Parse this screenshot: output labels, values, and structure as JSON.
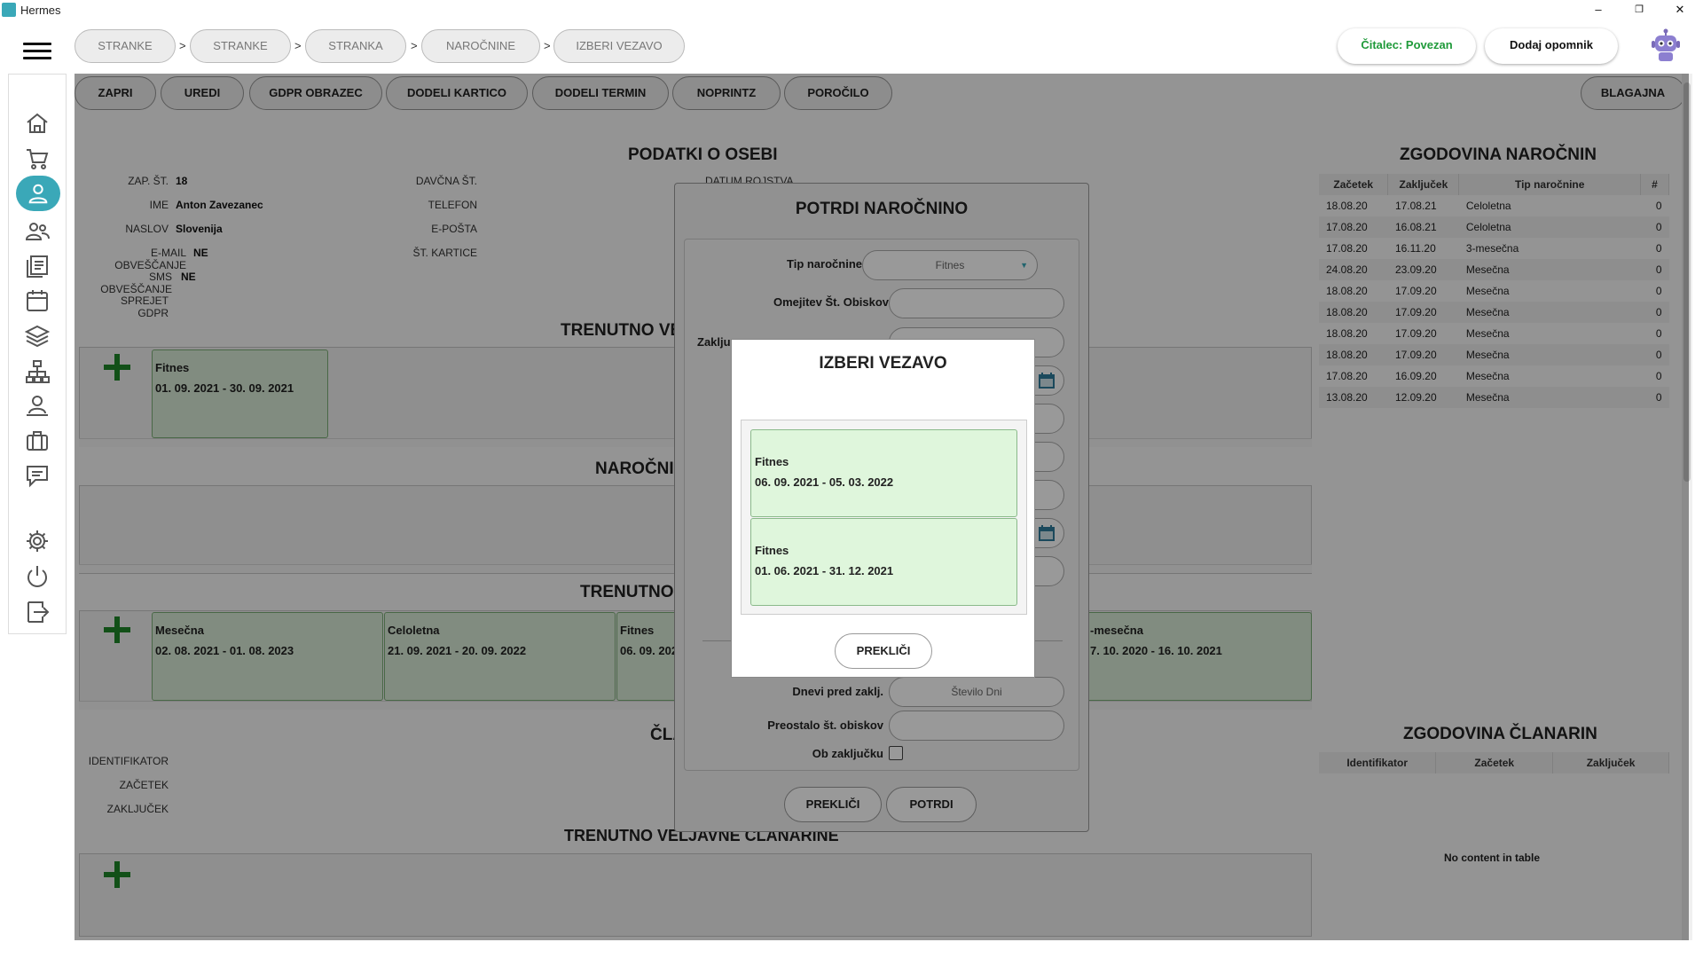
{
  "window": {
    "title": "Hermes",
    "minimize": "–",
    "restore": "❐",
    "close": "✕"
  },
  "breadcrumb": [
    {
      "label": "STRANKE"
    },
    {
      "label": "STRANKE"
    },
    {
      "label": "STRANKA"
    },
    {
      "label": "NAROČNINE"
    },
    {
      "label": "IZBERI VEZAVO"
    }
  ],
  "breadcrumb_sep": ">",
  "header": {
    "reader_status": "Čitalec: Povezan",
    "add_reminder": "Dodaj opomnik",
    "reader_color": "#1f9a3a"
  },
  "sidebar": {
    "icons": [
      "home-icon",
      "cart-icon",
      "person-icon",
      "people-icon",
      "documents-icon",
      "calendar-icon",
      "layers-icon",
      "network-icon",
      "user-desk-icon",
      "briefcase-icon",
      "chat-icon",
      "gear-icon",
      "power-icon",
      "logout-icon"
    ]
  },
  "toolbar": {
    "buttons": [
      "ZAPRI",
      "UREDI",
      "GDPR OBRAZEC",
      "DODELI KARTICO",
      "DODELI TERMIN",
      "NOPRINTZ",
      "POROČILO"
    ],
    "cashier": "BLAGAJNA"
  },
  "person": {
    "title": "PODATKI O OSEBI",
    "zap_label": "ZAP. ŠT.",
    "zap_value": "18",
    "ime_label": "IME",
    "ime_value": "Anton Zavezanec",
    "naslov_label": "NASLOV",
    "naslov_value": "Slovenija",
    "email_label": "E-MAIL OBVEŠČANJE",
    "email_value": "NE",
    "sms_label": "SMS OBVEŠČANJE",
    "sms_value": "NE",
    "gdpr_label": "SPREJET GDPR",
    "davcna_label": "DAVČNA ŠT.",
    "telefon_label": "TELEFON",
    "eposta_label": "E-POŠTA",
    "kartica_label": "ŠT. KARTICE",
    "datum_label": "DATUM ROJSTVA"
  },
  "current_valid": {
    "title": "TRENUTNO VE",
    "card_name": "Fitnes",
    "card_range": "01. 09. 2021 - 30. 09. 2021"
  },
  "subscriptions": {
    "title": "NAROČNI"
  },
  "current_block": {
    "title": "TRENUTNO V",
    "cards": [
      {
        "name": "Mesečna",
        "range": "02. 08. 2021 - 01. 08. 2023"
      },
      {
        "name": "Celoletna",
        "range": "21. 09. 2021 - 20. 09. 2022"
      },
      {
        "name": "Fitnes",
        "range": "06. 09. 202"
      },
      {
        "name": "-mesečna",
        "range": "7. 10. 2020 - 16. 10. 2021"
      }
    ]
  },
  "membership": {
    "title": "ČLA",
    "id_label": "IDENTIFIKATOR",
    "start_label": "ZAČETEK",
    "end_label": "ZAKLJUČEK",
    "current_title": "TRENUTNO VELJAVNE ČLANARINE"
  },
  "history_subs": {
    "title": "ZGODOVINA NAROČNIN",
    "columns": [
      "Začetek",
      "Zaključek",
      "Tip naročnine",
      "#"
    ],
    "rows": [
      [
        "18.08.20",
        "17.08.21",
        "Celoletna",
        "0"
      ],
      [
        "17.08.20",
        "16.08.21",
        "Celoletna",
        "0"
      ],
      [
        "17.08.20",
        "16.11.20",
        "3-mesečna",
        "0"
      ],
      [
        "24.08.20",
        "23.09.20",
        "Mesečna",
        "0"
      ],
      [
        "18.08.20",
        "17.09.20",
        "Mesečna",
        "0"
      ],
      [
        "18.08.20",
        "17.09.20",
        "Mesečna",
        "0"
      ],
      [
        "18.08.20",
        "17.09.20",
        "Mesečna",
        "0"
      ],
      [
        "18.08.20",
        "17.09.20",
        "Mesečna",
        "0"
      ],
      [
        "17.08.20",
        "16.09.20",
        "Mesečna",
        "0"
      ],
      [
        "13.08.20",
        "12.09.20",
        "Mesečna",
        "0"
      ]
    ]
  },
  "history_membership": {
    "title": "ZGODOVINA ČLANARIN",
    "columns": [
      "Identifikator",
      "Začetek",
      "Zaključek"
    ],
    "empty": "No content in table"
  },
  "confirm_dialog": {
    "title": "POTRDI NAROČNINO",
    "type_label": "Tip naročnine",
    "required": "*",
    "type_value": "Fitnes",
    "limit_label": "Omejitev Št. Obiskov",
    "end_label": "Zaklju",
    "days_label": "Dnevi pred zaklj.",
    "days_placeholder": "Število Dni",
    "remaining_label": "Preostalo št. obiskov",
    "on_end_label": "Ob zaključku",
    "cancel": "PREKLIČI",
    "confirm": "POTRDI"
  },
  "bind_dialog": {
    "title": "IZBERI VEZAVO",
    "options": [
      {
        "name": "Fitnes",
        "range": "06. 09. 2021 - 05. 03. 2022"
      },
      {
        "name": "Fitnes",
        "range": "01. 06. 2021 - 31. 12. 2021"
      }
    ],
    "cancel": "PREKLIČI"
  }
}
